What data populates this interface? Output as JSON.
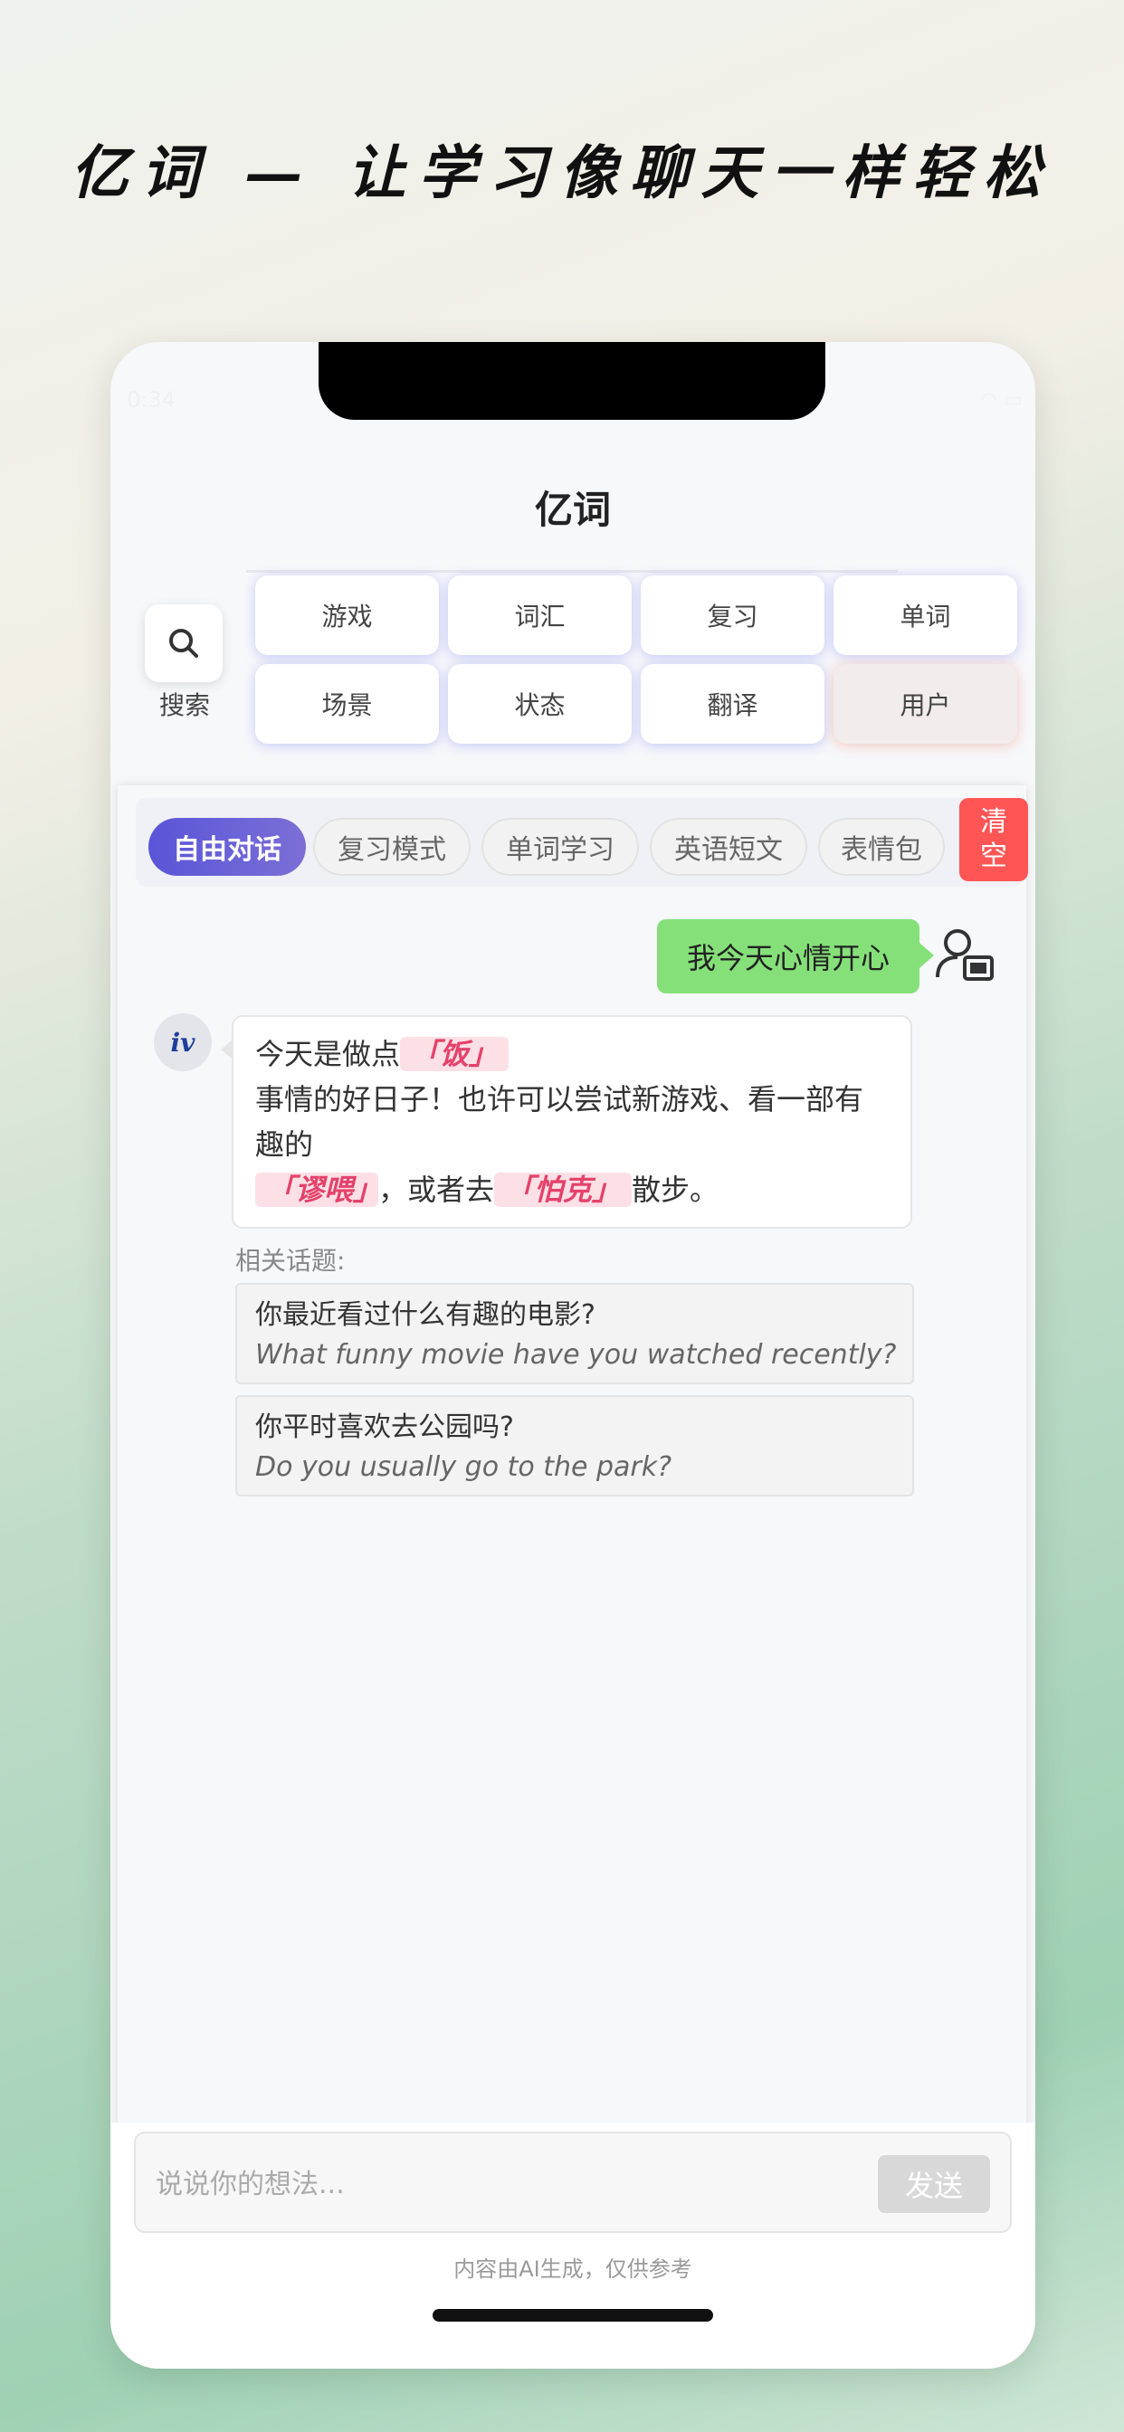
{
  "headline": "亿词 — 让学习像聊天一样轻松",
  "status": {
    "time": "0:34"
  },
  "app": {
    "title": "亿词"
  },
  "search": {
    "label": "搜索"
  },
  "nav": {
    "buttons": [
      "游戏",
      "词汇",
      "复习",
      "单词",
      "场景",
      "状态",
      "翻译",
      "用户"
    ]
  },
  "tabs": {
    "items": [
      "自由对话",
      "复习模式",
      "单词学习",
      "英语短文",
      "表情包"
    ],
    "clear": "清空"
  },
  "chat": {
    "user_message": "我今天心情开心",
    "bot_avatar": "iv",
    "bot_message": {
      "part1": "今天是做点",
      "kw1": "「饭」",
      "part2": "事情的好日子！也许可以尝试新游戏、看一部有趣的",
      "kw2": "「谬喂」",
      "part3": "，或者去",
      "kw3": "「怕克」",
      "part4": "散步。"
    },
    "related_title": "相关话题:",
    "topics": [
      {
        "zh": "你最近看过什么有趣的电影?",
        "en": "What funny movie have you watched recently?"
      },
      {
        "zh": "你平时喜欢去公园吗?",
        "en": "Do you usually go to the park?"
      }
    ]
  },
  "input": {
    "placeholder": "说说你的想法...",
    "send": "发送",
    "disclaimer": "内容由AI生成，仅供参考"
  },
  "colors": {
    "active_tab": "#5b5bd6",
    "user_bubble": "#86e07a",
    "clear_button": "#ff5555",
    "keyword": "#e4426b"
  }
}
